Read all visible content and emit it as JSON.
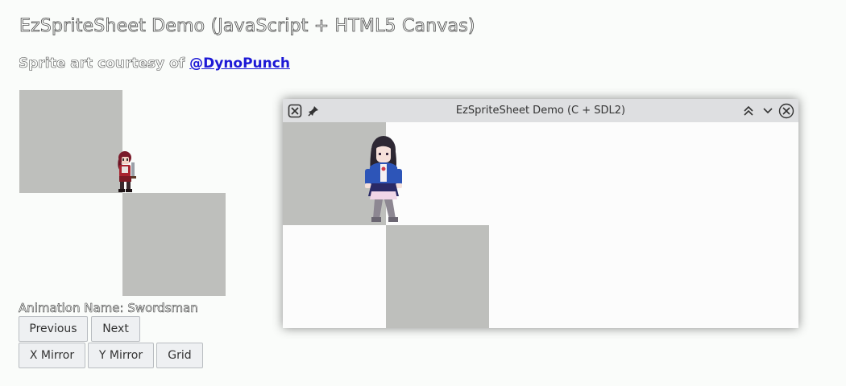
{
  "page": {
    "title": "EzSpriteSheet Demo (JavaScript + HTML5 Canvas)",
    "credit_prefix": "Sprite art courtesy of ",
    "credit_link": "@DynoPunch",
    "animation_label": "Animation Name: Swordsman"
  },
  "buttons": {
    "previous": "Previous",
    "next": "Next",
    "x_mirror": "X Mirror",
    "y_mirror": "Y Mirror",
    "grid": "Grid"
  },
  "window": {
    "title": "EzSpriteSheet Demo (C + SDL2)"
  },
  "icons": {
    "app": "x-cross-icon",
    "pin": "pin-icon",
    "shade": "double-chevron-up-icon",
    "minimize": "chevron-down-icon",
    "close": "circle-close-icon"
  },
  "colors": {
    "background": "#fafcfa",
    "tile": "#bebfbc",
    "link": "#1d19d6",
    "titlebar": "#dedfe1",
    "button_bg": "#eef0f2"
  }
}
